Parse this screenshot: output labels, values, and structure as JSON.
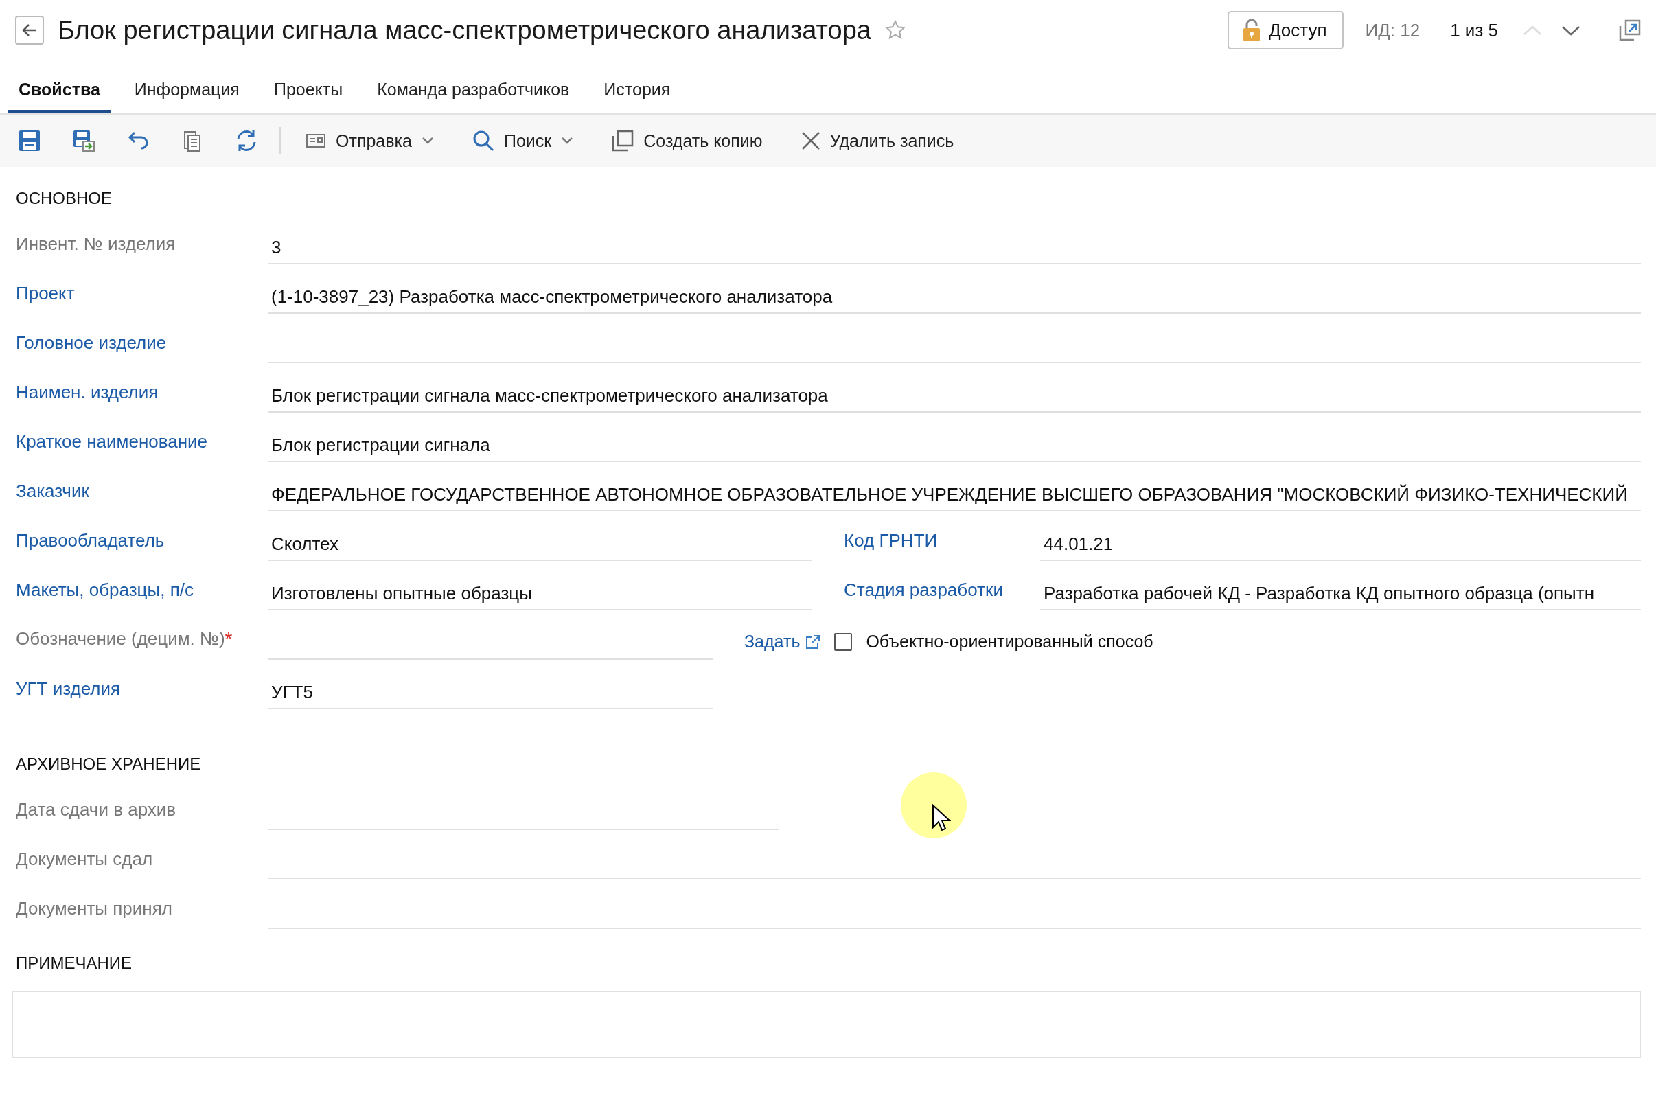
{
  "header": {
    "title": "Блок регистрации сигнала масс-спектрометрического анализатора",
    "access_button": "Доступ",
    "id_label": "ИД: 12",
    "pager": "1 из 5",
    "nav": [
      {
        "kind": "up",
        "disabled": true
      },
      {
        "kind": "down",
        "disabled": false
      }
    ]
  },
  "tabs": [
    {
      "label": "Свойства",
      "selected": true
    },
    {
      "label": "Информация",
      "selected": false
    },
    {
      "label": "Проекты",
      "selected": false
    },
    {
      "label": "Команда разработчиков",
      "selected": false
    },
    {
      "label": "История",
      "selected": false
    }
  ],
  "toolbar": {
    "actions": [
      {
        "label": "Отправка",
        "dropdown": true
      },
      {
        "label": "Поиск",
        "dropdown": true
      },
      {
        "label": "Создать копию",
        "dropdown": false
      },
      {
        "label": "Удалить запись",
        "dropdown": false
      }
    ]
  },
  "sections": [
    {
      "title": "ОСНОВНОЕ",
      "rows": [
        {
          "kind": "full",
          "fields": [
            {
              "label": "Инвент. № изделия",
              "link": false,
              "value": "3"
            }
          ]
        },
        {
          "kind": "full",
          "fields": [
            {
              "label": "Проект",
              "link": true,
              "value": "(1-10-3897_23) Разработка масс-спектрометрического анализатора"
            }
          ]
        },
        {
          "kind": "full",
          "fields": [
            {
              "label": "Головное изделие",
              "link": true
            }
          ]
        },
        {
          "kind": "full",
          "fields": [
            {
              "label": "Наимен. изделия",
              "link": true,
              "value": "Блок регистрации сигнала масс-спектрометрического анализатора"
            }
          ]
        },
        {
          "kind": "full",
          "fields": [
            {
              "label": "Краткое наименование",
              "link": true,
              "value": "Блок регистрации сигнала"
            }
          ]
        },
        {
          "kind": "full",
          "fields": [
            {
              "label": "Заказчик",
              "link": true,
              "value": "ФЕДЕРАЛЬНОЕ ГОСУДАРСТВЕННОЕ АВТОНОМНОЕ ОБРАЗОВАТЕЛЬНОЕ УЧРЕЖДЕНИЕ ВЫСШЕГО ОБРАЗОВАНИЯ \"МОСКОВСКИЙ ФИЗИКО-ТЕХНИЧЕСКИЙ"
            }
          ]
        },
        {
          "kind": "pair",
          "fields": [
            {
              "label": "Правообладатель",
              "link": true,
              "value": "Сколтех"
            },
            {
              "label": "Код ГРНТИ",
              "link": true,
              "value": "44.01.21"
            }
          ]
        },
        {
          "kind": "pair",
          "fields": [
            {
              "label": "Макеты, образцы, п/с",
              "link": true,
              "value": "Изготовлены опытные образцы"
            },
            {
              "label": "Стадия разработки",
              "link": true,
              "value": "Разработка рабочей КД - Разработка КД опытного образца (опытн"
            }
          ]
        },
        {
          "kind": "short",
          "fields": [
            {
              "label": "Обозначение (децим. №)",
              "link": false,
              "required_mark": "*"
            }
          ],
          "set_link": "Задать",
          "checkbox": {
            "label": "Объектно-ориентированный способ",
            "checked": false
          }
        },
        {
          "kind": "short",
          "fields": [
            {
              "label": "УГТ изделия",
              "link": true,
              "value": "УГТ5"
            }
          ]
        }
      ]
    },
    {
      "title": "АРХИВНОЕ ХРАНЕНИЕ",
      "rows": [
        {
          "kind": "medium",
          "fields": [
            {
              "label": "Дата сдачи в архив",
              "link": false
            }
          ]
        },
        {
          "kind": "full",
          "fields": [
            {
              "label": "Документы сдал",
              "link": false
            }
          ]
        },
        {
          "kind": "full",
          "fields": [
            {
              "label": "Документы принял",
              "link": false
            }
          ]
        }
      ]
    }
  ],
  "note": {
    "title": "ПРИМЕЧАНИЕ"
  }
}
